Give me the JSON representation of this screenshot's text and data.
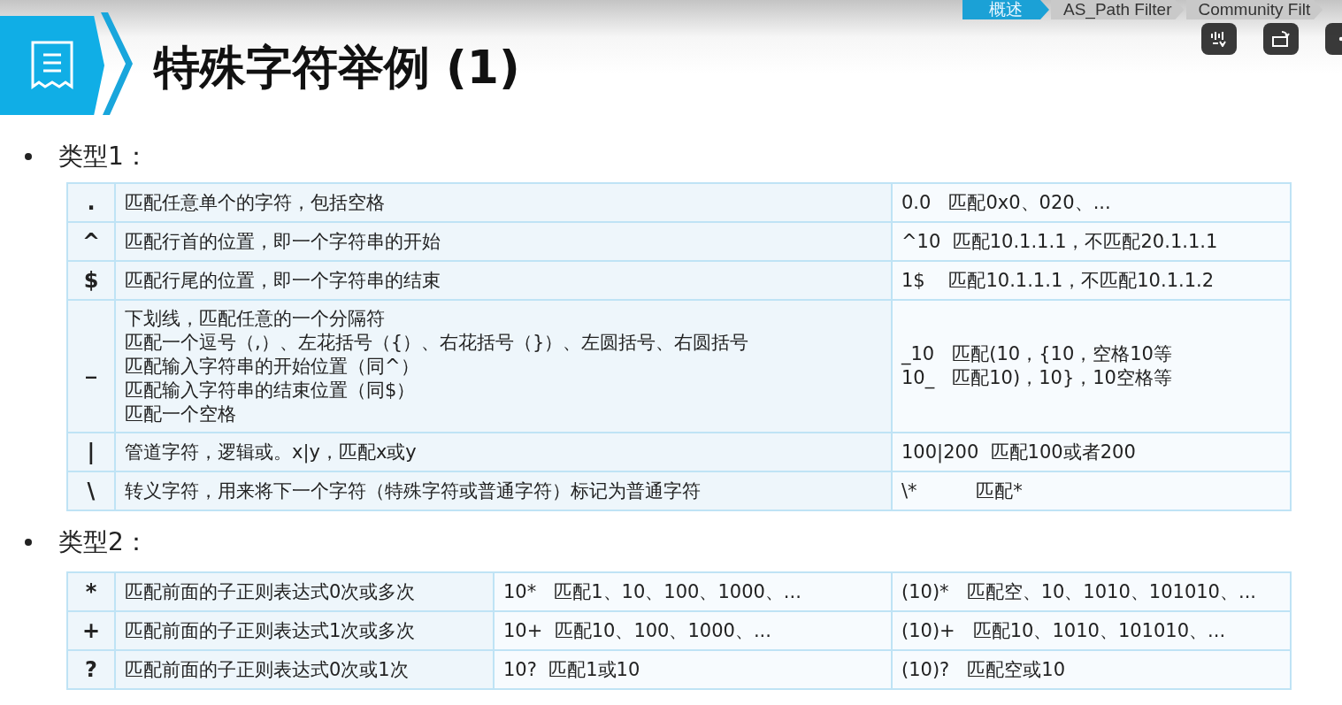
{
  "breadcrumb": [
    {
      "label": "概述",
      "selected": true
    },
    {
      "label": "AS_Path Filter",
      "selected": false
    },
    {
      "label": "Community Filt",
      "selected": false
    }
  ],
  "player_controls": [
    {
      "kind": "subtitles"
    },
    {
      "kind": "rotate"
    },
    {
      "kind": "more"
    }
  ],
  "slide": {
    "title": "特殊字符举例 (1)",
    "sections": [
      {
        "heading": "类型1：",
        "rows": [
          {
            "symbol": ".",
            "cells": [
              [
                "匹配任意单个的字符，包括空格"
              ],
              [
                "0.0   匹配0x0、020、..."
              ]
            ]
          },
          {
            "symbol": "^",
            "cells": [
              [
                "匹配行首的位置，即一个字符串的开始"
              ],
              [
                "^10  匹配10.1.1.1，不匹配20.1.1.1"
              ]
            ]
          },
          {
            "symbol": "$",
            "cells": [
              [
                "匹配行尾的位置，即一个字符串的结束"
              ],
              [
                "1$    匹配10.1.1.1，不匹配10.1.1.2"
              ]
            ]
          },
          {
            "symbol": "_",
            "cells": [
              [
                "下划线，匹配任意的一个分隔符",
                "匹配一个逗号（,）、左花括号（{）、右花括号（}）、左圆括号、右圆括号",
                "匹配输入字符串的开始位置（同^）",
                "匹配输入字符串的结束位置（同$）",
                "匹配一个空格"
              ],
              [
                "_10   匹配(10，{10，空格10等",
                "10_   匹配10)，10}，10空格等"
              ]
            ]
          },
          {
            "symbol": "|",
            "cells": [
              [
                "管道字符，逻辑或。x|y，匹配x或y"
              ],
              [
                "100|200  匹配100或者200"
              ]
            ]
          },
          {
            "symbol": "\\",
            "cells": [
              [
                "转义字符，用来将下一个字符（特殊字符或普通字符）标记为普通字符"
              ],
              [
                "\\*          匹配*"
              ]
            ]
          }
        ]
      },
      {
        "heading": "类型2：",
        "rows": [
          {
            "symbol": "*",
            "cells": [
              [
                "匹配前面的子正则表达式0次或多次"
              ],
              [
                "10*   匹配1、10、100、1000、..."
              ],
              [
                "(10)*   匹配空、10、1010、101010、..."
              ]
            ]
          },
          {
            "symbol": "+",
            "cells": [
              [
                "匹配前面的子正则表达式1次或多次"
              ],
              [
                "10+  匹配10、100、1000、..."
              ],
              [
                "(10)+   匹配10、1010、101010、..."
              ]
            ]
          },
          {
            "symbol": "?",
            "cells": [
              [
                "匹配前面的子正则表达式0次或1次"
              ],
              [
                "10?  匹配1或10"
              ],
              [
                "(10)?   匹配空或10"
              ]
            ]
          }
        ]
      }
    ]
  }
}
